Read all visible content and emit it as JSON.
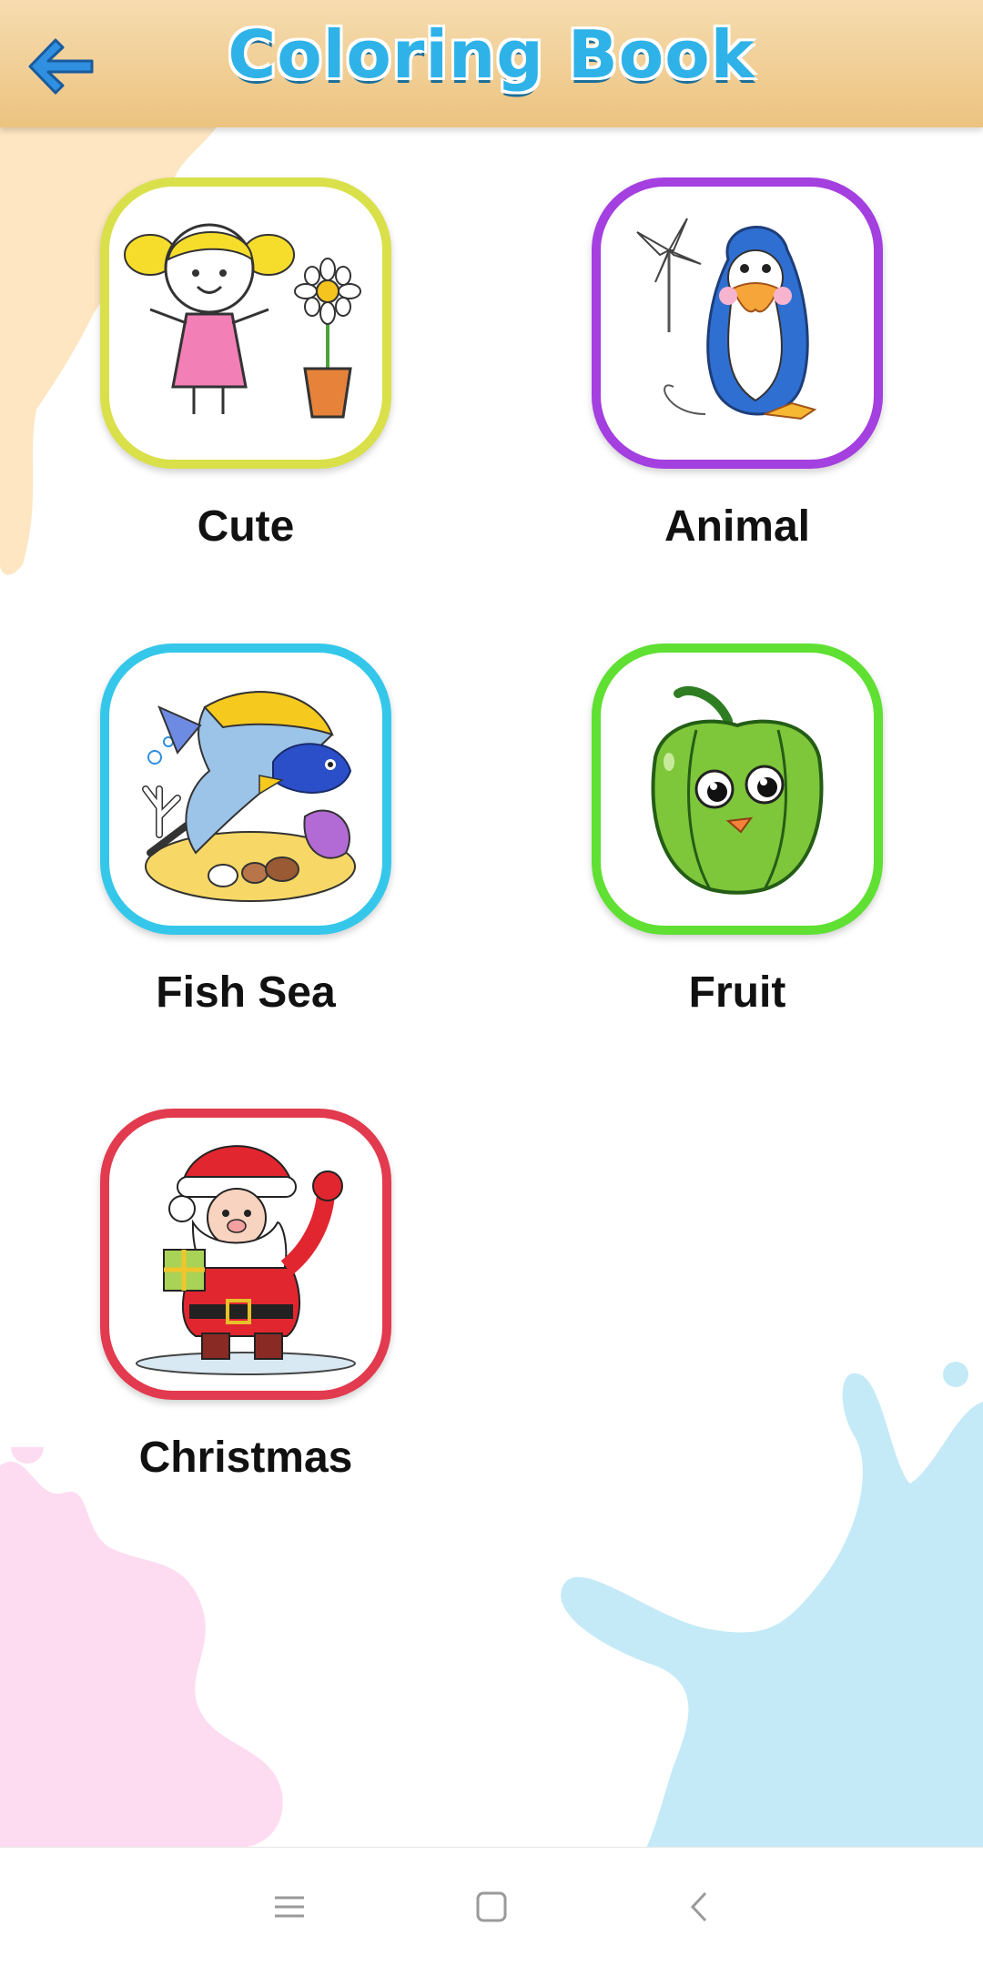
{
  "header": {
    "title": "Coloring Book",
    "back_icon": "arrow-left-icon",
    "title_color": "#2fb2e8",
    "background": "#ecc37f"
  },
  "categories": [
    {
      "label": "Cute",
      "frame_color": "#d9e04a",
      "icon": "girl-flower-icon"
    },
    {
      "label": "Animal",
      "frame_color": "#a43fe0",
      "icon": "penguin-icon"
    },
    {
      "label": "Fish Sea",
      "frame_color": "#35c7ea",
      "icon": "fish-icon"
    },
    {
      "label": "Fruit",
      "frame_color": "#5fe032",
      "icon": "pepper-icon"
    },
    {
      "label": "Christmas",
      "frame_color": "#e23a4e",
      "icon": "santa-icon"
    }
  ],
  "navbar": {
    "menu_icon": "menu-icon",
    "home_icon": "home-square-icon",
    "back_icon": "chevron-left-icon"
  }
}
